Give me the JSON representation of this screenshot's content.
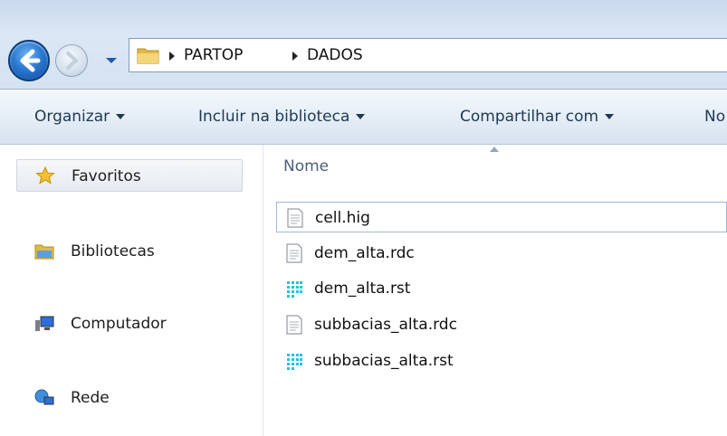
{
  "address_bar": {
    "crumbs": [
      "PARTOP",
      "DADOS"
    ]
  },
  "toolbar": {
    "organize": "Organizar",
    "include_library": "Incluir na biblioteca",
    "share_with": "Compartilhar com",
    "new_folder_partial": "No"
  },
  "nav": {
    "favorites": "Favoritos",
    "libraries": "Bibliotecas",
    "computer": "Computador",
    "network": "Rede"
  },
  "content": {
    "column_name": "Nome",
    "files": [
      {
        "name": "cell.hig",
        "icon": "document-icon"
      },
      {
        "name": "dem_alta.rdc",
        "icon": "document-icon"
      },
      {
        "name": "dem_alta.rst",
        "icon": "raster-icon"
      },
      {
        "name": "subbacias_alta.rdc",
        "icon": "document-icon"
      },
      {
        "name": "subbacias_alta.rst",
        "icon": "raster-icon"
      }
    ]
  },
  "colors": {
    "toolbar_text": "#1e3956",
    "raster_icon": "#22c3e0",
    "back_button": "#2a79d1"
  }
}
